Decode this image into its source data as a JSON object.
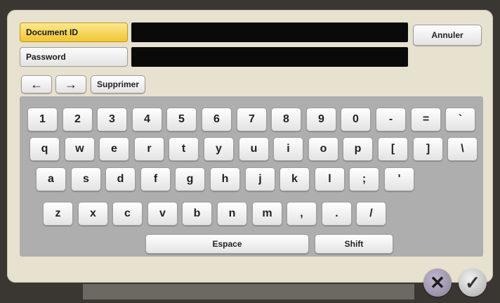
{
  "fields": {
    "document_id_label": "Document ID",
    "password_label": "Password",
    "document_id_value": "",
    "password_value": ""
  },
  "buttons": {
    "cancel": "Annuler",
    "left_arrow": "←",
    "right_arrow": "→",
    "delete": "Supprimer",
    "space": "Espace",
    "shift": "Shift",
    "close_glyph": "✕",
    "ok_glyph": "✓"
  },
  "keyboard": {
    "row1": [
      "1",
      "2",
      "3",
      "4",
      "5",
      "6",
      "7",
      "8",
      "9",
      "0",
      "-",
      "=",
      "`"
    ],
    "row2": [
      "q",
      "w",
      "e",
      "r",
      "t",
      "y",
      "u",
      "i",
      "o",
      "p",
      "[",
      "]",
      "\\"
    ],
    "row3": [
      "a",
      "s",
      "d",
      "f",
      "g",
      "h",
      "j",
      "k",
      "l",
      ";",
      "'"
    ],
    "row4": [
      "z",
      "x",
      "c",
      "v",
      "b",
      "n",
      "m",
      ",",
      ".",
      "/"
    ]
  },
  "colors": {
    "active_field": "#f1c532",
    "panel": "#aeaeae",
    "frame": "#e7e1cf"
  },
  "icons": {
    "left": "arrow-left-icon",
    "right": "arrow-right-icon",
    "close": "close-icon",
    "ok": "checkmark-icon"
  }
}
